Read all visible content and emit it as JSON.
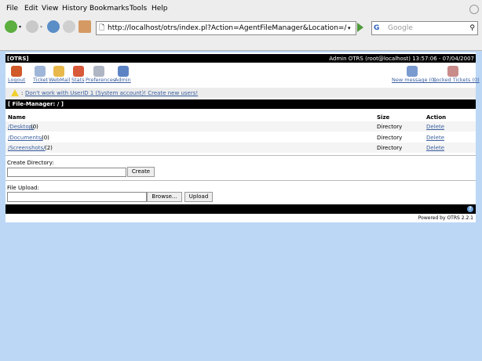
{
  "browser": {
    "menu": [
      "File",
      "Edit",
      "View",
      "History",
      "Bookmarks",
      "Tools",
      "Help"
    ],
    "url": "http://localhost/otrs/index.pl?Action=AgentFileManager&Location=/",
    "search_placeholder": "Google",
    "search_engine_letter": "G"
  },
  "otrs": {
    "title": "[OTRS]",
    "user_info": "Admin OTRS (root@localhost) 13:57:06 - 07/04/2007",
    "nav": [
      "Logout",
      "Ticket",
      "WebMail",
      "Stats",
      "Preferences",
      "Admin"
    ],
    "new_message": "New message (0)",
    "locked_tickets": "Locked Tickets (0)",
    "warning": "Don't work with UserID 1 (System account)! Create new users!",
    "section_title": "[ File-Manager: / ]",
    "columns": {
      "name": "Name",
      "size": "Size",
      "action": "Action"
    },
    "rows": [
      {
        "name": "/Desktop/",
        "count": "(0)",
        "size": "Directory",
        "action": "Delete"
      },
      {
        "name": "/Documents/",
        "count": "(0)",
        "size": "Directory",
        "action": "Delete"
      },
      {
        "name": "/Screenshots/",
        "count": "(2)",
        "size": "Directory",
        "action": "Delete"
      }
    ],
    "create_dir_label": "Create Directory:",
    "create_button": "Create",
    "upload_label": "File Upload:",
    "browse_button": "Browse...",
    "upload_button": "Upload",
    "footer": "Powered by OTRS 2.2.1",
    "help_glyph": "?"
  },
  "colors": {
    "accent_blue": "#3a5fa0",
    "page_bg": "#bcd7f5",
    "warning": "#f0d030"
  }
}
